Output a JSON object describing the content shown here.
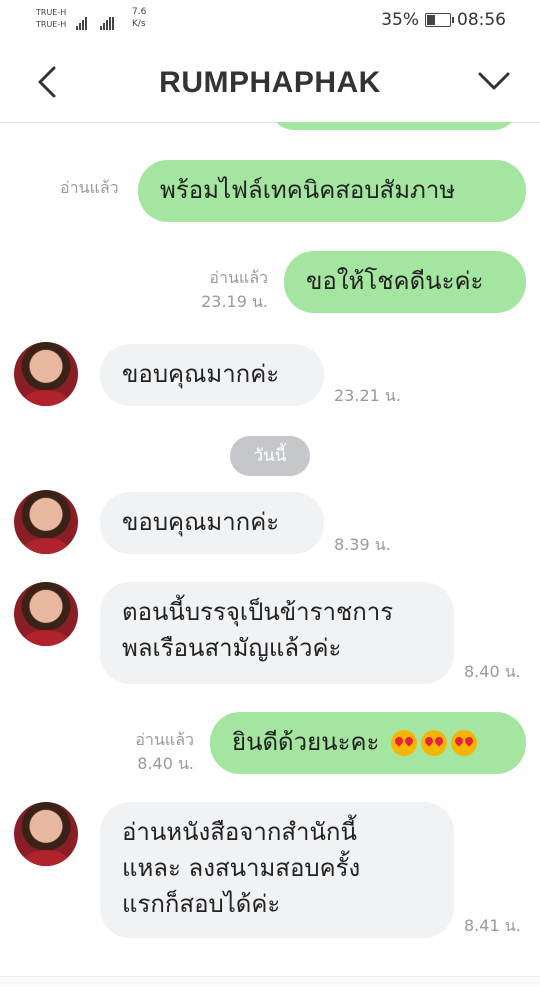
{
  "status": {
    "carrier1": "TRUE-H",
    "carrier2": "TRUE-H",
    "speed_value": "7.6",
    "speed_unit": "K/s",
    "battery": "35%",
    "time": "08:56"
  },
  "header": {
    "title": "RUMPHAPHAK"
  },
  "messages": [
    {
      "text": "พร้อมไฟล์เทคนิคสอบสัมภาษ",
      "read": "อ่านแล้ว",
      "time": ""
    },
    {
      "text": "ขอให้โชคดีนะค่ะ",
      "read": "อ่านแล้ว",
      "time": "23.19 น."
    },
    {
      "text": "ขอบคุณมากค่ะ",
      "time": "23.21 น."
    },
    {
      "text": "ขอบคุณมากค่ะ",
      "time": "8.39 น."
    },
    {
      "line1": "ตอนนี้บรรจุเป็นข้าราชการ",
      "line2": "พลเรือนสามัญแล้วค่ะ",
      "time": "8.40 น."
    },
    {
      "text": "ยินดีด้วยนะคะ",
      "read": "อ่านแล้ว",
      "time": "8.40 น."
    },
    {
      "line1": "อ่านหนังสือจากสำนักนี้",
      "line2": "แหละ ลงสนามสอบครั้ง",
      "line3": "แรกก็สอบได้ค่ะ",
      "time": "8.41 น."
    }
  ],
  "day_separator": "วันนี้",
  "colors": {
    "outgoing": "#a4e6a0",
    "incoming": "#f1f2f4"
  }
}
